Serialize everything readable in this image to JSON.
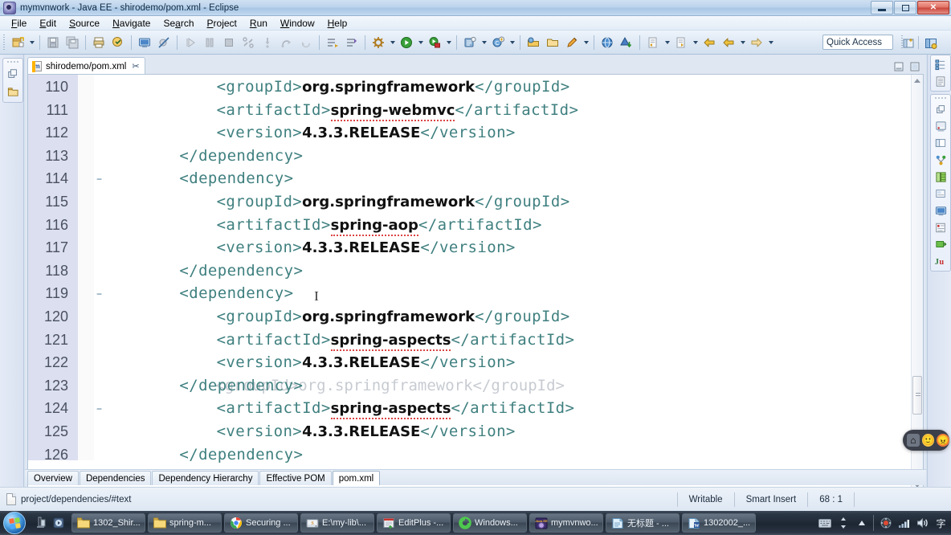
{
  "window": {
    "title": "mymvnwork - Java EE - shirodemo/pom.xml - Eclipse",
    "app_icon": "eclipse-icon",
    "minimize_label": "Minimize",
    "restore_label": "Restore",
    "close_label": "Close"
  },
  "menubar": {
    "items": [
      {
        "label": "File",
        "mnemonic": "F"
      },
      {
        "label": "Edit",
        "mnemonic": "E"
      },
      {
        "label": "Source",
        "mnemonic": "S"
      },
      {
        "label": "Navigate",
        "mnemonic": "N"
      },
      {
        "label": "Search",
        "mnemonic": "a"
      },
      {
        "label": "Project",
        "mnemonic": "P"
      },
      {
        "label": "Run",
        "mnemonic": "R"
      },
      {
        "label": "Window",
        "mnemonic": "W"
      },
      {
        "label": "Help",
        "mnemonic": "H"
      }
    ]
  },
  "toolbar": {
    "quick_access_placeholder": "Quick Access",
    "quick_access_value": "Quick Access",
    "buttons": [
      {
        "name": "new-wizard-icon",
        "title": "New"
      },
      {
        "name": "new-wizard-dropdown-icon",
        "title": "New dropdown"
      },
      {
        "name": "save-icon",
        "title": "Save"
      },
      {
        "name": "save-all-icon",
        "title": "Save All"
      },
      {
        "name": "print-icon",
        "title": "Print"
      },
      {
        "name": "validate-icon",
        "title": "Validate"
      },
      {
        "name": "open-console-icon",
        "title": "Open Console"
      },
      {
        "name": "skip-breakpoints-icon",
        "title": "Skip All Breakpoints"
      },
      {
        "name": "resume-icon",
        "title": "Resume"
      },
      {
        "name": "suspend-icon",
        "title": "Suspend"
      },
      {
        "name": "terminate-icon",
        "title": "Terminate"
      },
      {
        "name": "disconnect-icon",
        "title": "Disconnect"
      },
      {
        "name": "step-into-icon",
        "title": "Step Into"
      },
      {
        "name": "step-over-icon",
        "title": "Step Over"
      },
      {
        "name": "step-return-icon",
        "title": "Step Return"
      },
      {
        "name": "next-annotation-icon",
        "title": "Next Annotation"
      },
      {
        "name": "previous-annotation-icon",
        "title": "Previous Annotation"
      },
      {
        "name": "external-tools-icon",
        "title": "External Tools"
      },
      {
        "name": "run-icon",
        "title": "Run"
      },
      {
        "name": "debug-icon",
        "title": "Debug"
      },
      {
        "name": "new-java-project-icon",
        "title": "New Java Project"
      },
      {
        "name": "new-class-icon",
        "title": "New Class"
      },
      {
        "name": "open-type-icon",
        "title": "Open Type"
      },
      {
        "name": "open-task-icon",
        "title": "Open Task"
      },
      {
        "name": "search-icon",
        "title": "Search"
      },
      {
        "name": "web-browser-icon",
        "title": "Web Browser"
      },
      {
        "name": "deploy-icon",
        "title": "Deploy"
      },
      {
        "name": "previous-edit-icon",
        "title": "Previous Edit Location"
      },
      {
        "name": "next-edit-icon",
        "title": "Next Edit Location"
      },
      {
        "name": "back-icon",
        "title": "Back"
      },
      {
        "name": "forward-icon",
        "title": "Forward"
      }
    ],
    "perspective_buttons": [
      {
        "name": "open-perspective-icon",
        "title": "Open Perspective"
      },
      {
        "name": "java-ee-perspective-icon",
        "title": "Java EE"
      }
    ]
  },
  "left_bar": {
    "restore_label": "Restore",
    "items": [
      {
        "name": "restore-icon",
        "title": "Restore"
      },
      {
        "name": "project-explorer-icon",
        "title": "Project Explorer"
      }
    ]
  },
  "right_bar": {
    "groups": [
      {
        "items": [
          {
            "name": "outline-icon",
            "title": "Outline"
          },
          {
            "name": "task-list-icon",
            "title": "Task List"
          }
        ]
      },
      {
        "items": [
          {
            "name": "restore-icon",
            "title": "Restore"
          },
          {
            "name": "servers-icon",
            "title": "Servers"
          },
          {
            "name": "properties-icon",
            "title": "Properties"
          },
          {
            "name": "snippets-icon",
            "title": "Snippets"
          },
          {
            "name": "data-source-explorer-icon",
            "title": "Data Source Explorer"
          },
          {
            "name": "markers-icon",
            "title": "Markers"
          },
          {
            "name": "console-icon",
            "title": "Console"
          },
          {
            "name": "problems-icon",
            "title": "Problems"
          },
          {
            "name": "progress-icon",
            "title": "Progress"
          },
          {
            "name": "junit-icon",
            "title": "JUnit"
          }
        ]
      }
    ]
  },
  "editor": {
    "tab": {
      "label": "shirodemo/pom.xml",
      "icon": "maven-pom-icon",
      "close_glyph": "✂",
      "close_label": "Close tab"
    },
    "tab_tools": [
      {
        "name": "minimize-editor-icon",
        "title": "Minimize"
      },
      {
        "name": "maximize-editor-icon",
        "title": "Maximize"
      }
    ],
    "first_line_number": 110,
    "lines": [
      {
        "no": "110",
        "fold": "",
        "indent": 12,
        "segments": [
          {
            "t": "tag",
            "v": "<groupId>"
          },
          {
            "t": "txt",
            "v": "org.springframework"
          },
          {
            "t": "tag",
            "v": "</groupId>"
          }
        ]
      },
      {
        "no": "111",
        "fold": "",
        "indent": 12,
        "segments": [
          {
            "t": "tag",
            "v": "<artifactId>"
          },
          {
            "t": "txt",
            "v": "spring-webmvc",
            "spell": true
          },
          {
            "t": "tag",
            "v": "</artifactId>"
          }
        ]
      },
      {
        "no": "112",
        "fold": "",
        "indent": 12,
        "segments": [
          {
            "t": "tag",
            "v": "<version>"
          },
          {
            "t": "txt",
            "v": "4.3.3.RELEASE"
          },
          {
            "t": "tag",
            "v": "</version>"
          }
        ]
      },
      {
        "no": "113",
        "fold": "",
        "indent": 8,
        "segments": [
          {
            "t": "tag",
            "v": "</dependency>"
          }
        ]
      },
      {
        "no": "114",
        "fold": "−",
        "indent": 8,
        "segments": [
          {
            "t": "tag",
            "v": "<dependency>"
          }
        ]
      },
      {
        "no": "115",
        "fold": "",
        "indent": 12,
        "segments": [
          {
            "t": "tag",
            "v": "<groupId>"
          },
          {
            "t": "txt",
            "v": "org.springframework"
          },
          {
            "t": "tag",
            "v": "</groupId>"
          }
        ]
      },
      {
        "no": "116",
        "fold": "",
        "indent": 12,
        "segments": [
          {
            "t": "tag",
            "v": "<artifactId>"
          },
          {
            "t": "txt",
            "v": "spring-aop",
            "spell": true
          },
          {
            "t": "tag",
            "v": "</artifactId>"
          }
        ]
      },
      {
        "no": "117",
        "fold": "",
        "indent": 12,
        "segments": [
          {
            "t": "tag",
            "v": "<version>"
          },
          {
            "t": "txt",
            "v": "4.3.3.RELEASE"
          },
          {
            "t": "tag",
            "v": "</version>"
          }
        ]
      },
      {
        "no": "118",
        "fold": "",
        "indent": 8,
        "segments": [
          {
            "t": "tag",
            "v": "</dependency>"
          }
        ]
      },
      {
        "no": "119",
        "fold": "−",
        "indent": 8,
        "segments": [
          {
            "t": "tag",
            "v": "<dependency>"
          }
        ],
        "caret": true
      },
      {
        "no": "120",
        "fold": "",
        "indent": 12,
        "segments": [
          {
            "t": "tag",
            "v": "<groupId>"
          },
          {
            "t": "txt",
            "v": "org.springframework"
          },
          {
            "t": "tag",
            "v": "</groupId>"
          }
        ]
      },
      {
        "no": "121",
        "fold": "",
        "indent": 12,
        "segments": [
          {
            "t": "tag",
            "v": "<artifactId>"
          },
          {
            "t": "txt",
            "v": "spring-aspects",
            "spell": true
          },
          {
            "t": "tag",
            "v": "</artifactId>"
          }
        ]
      },
      {
        "no": "122",
        "fold": "",
        "indent": 12,
        "segments": [
          {
            "t": "tag",
            "v": "<version>"
          },
          {
            "t": "txt",
            "v": "4.3.3.RELEASE"
          },
          {
            "t": "tag",
            "v": "</version>"
          }
        ]
      },
      {
        "no": "123",
        "fold": "",
        "indent": 8,
        "segments": [
          {
            "t": "tag",
            "v": "</dependency>"
          }
        ],
        "ghost": "            <groupId>org.springframework</groupId>"
      },
      {
        "no": "124",
        "fold": "−",
        "indent": 12,
        "segments": [
          {
            "t": "tag",
            "v": "<artifactId>"
          },
          {
            "t": "txt",
            "v": "spring-aspects",
            "spell": true
          },
          {
            "t": "tag",
            "v": "</artifactId>"
          }
        ]
      },
      {
        "no": "125",
        "fold": "",
        "indent": 12,
        "segments": [
          {
            "t": "tag",
            "v": "<version>"
          },
          {
            "t": "txt",
            "v": "4.3.3.RELEASE"
          },
          {
            "t": "tag",
            "v": "</version>"
          }
        ]
      },
      {
        "no": "126",
        "fold": "",
        "indent": 8,
        "segments": [
          {
            "t": "tag",
            "v": "</dependency>"
          }
        ]
      }
    ]
  },
  "form_tabs": {
    "items": [
      {
        "label": "Overview",
        "active": false
      },
      {
        "label": "Dependencies",
        "active": false
      },
      {
        "label": "Dependency Hierarchy",
        "active": false
      },
      {
        "label": "Effective POM",
        "active": false
      },
      {
        "label": "pom.xml",
        "active": true
      }
    ]
  },
  "statusbar": {
    "selection_icon": "document-icon",
    "selection_path": "project/dependencies/#text",
    "writable": "Writable",
    "insert_mode": "Smart Insert",
    "caret_position": "68 : 1"
  },
  "taskbar": {
    "start_label": "Start",
    "quick_launch": [
      {
        "name": "show-desktop-icon",
        "title": "Show Desktop"
      },
      {
        "name": "media-player-icon",
        "title": "Windows Media Player"
      }
    ],
    "items": [
      {
        "label": "1302_Shir...",
        "icon": "folder-icon"
      },
      {
        "label": "spring-m...",
        "icon": "folder-icon"
      },
      {
        "label": "Securing ...",
        "icon": "chrome-icon"
      },
      {
        "label": "E:\\my-lib\\...",
        "icon": "drive-icon"
      },
      {
        "label": "EditPlus -...",
        "icon": "editplus-icon"
      },
      {
        "label": "Windows...",
        "icon": "windows-explorer-icon"
      },
      {
        "label": "mymvnwo...",
        "icon": "eclipse-icon"
      },
      {
        "label": "无标题 - ...",
        "icon": "notepad-icon"
      },
      {
        "label": "1302002_...",
        "icon": "word-icon"
      }
    ],
    "tray": [
      {
        "name": "show-hidden-icons-icon",
        "title": "Show hidden icons"
      },
      {
        "name": "keyboard-icon",
        "title": "Input method"
      },
      {
        "name": "updown-icon",
        "title": "Sort"
      },
      {
        "name": "triangle-up-icon",
        "title": "Show more"
      },
      {
        "name": "antivirus-icon",
        "title": "Antivirus"
      },
      {
        "name": "network-icon",
        "title": "Network"
      },
      {
        "name": "volume-icon",
        "title": "Volume"
      },
      {
        "name": "ime-icon",
        "title": "IME"
      }
    ]
  },
  "chat_widget": {
    "home_glyph": "⌂",
    "emojis": [
      "😀",
      "😠"
    ],
    "home_label": "Home"
  },
  "colors": {
    "tag": "#3f7f7f",
    "text": "#111111",
    "gutter_bg": "#e7e9f5",
    "gutter_selected": "#dcdff0",
    "editor_bg": "#ffffff",
    "chrome": "#d6e3f0",
    "taskbar": "#1d2733",
    "spell_underline": "#dd4444"
  }
}
